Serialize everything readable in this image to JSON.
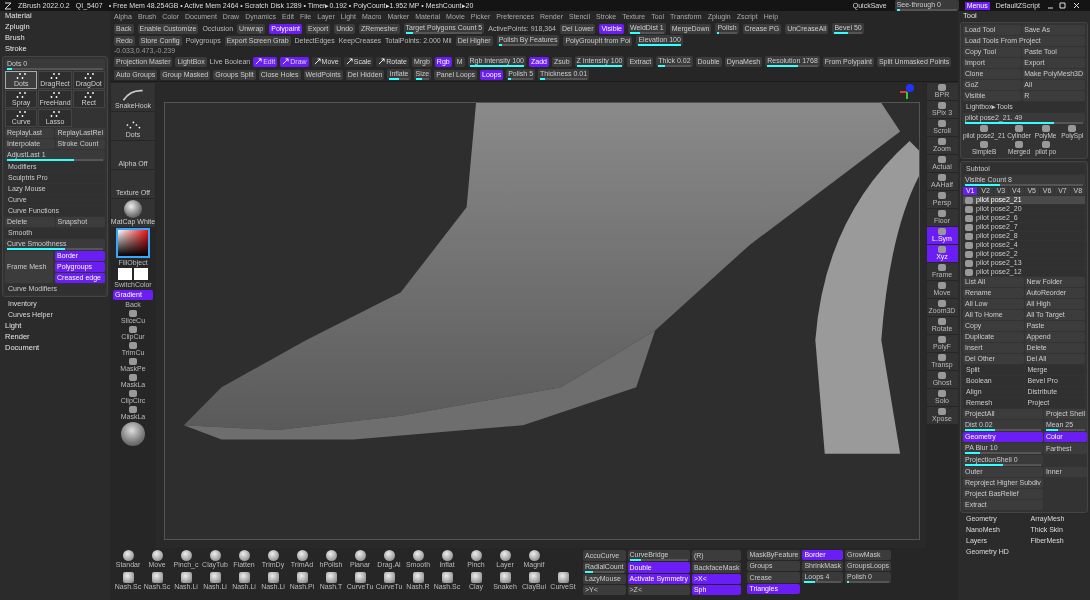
{
  "title_bar": {
    "app": "ZBrush 2022.0.2",
    "file": "QI_5407",
    "stats": "• Free Mem 48.254GB • Active Mem 2464 • Scratch Disk 1289 • Timer▸0.192 • PolyCount▸1.952 MP • MeshCount▸20",
    "quicksave": "QuickSave",
    "see_through": {
      "label": "See-through 0",
      "level": 0.05
    },
    "menus": {
      "label": "Menus",
      "selected": true
    },
    "script": "DefaultZScript"
  },
  "menu_bar": [
    "Alpha",
    "Brush",
    "Color",
    "Document",
    "Draw",
    "Dynamics",
    "Edit",
    "File",
    "Layer",
    "Light",
    "Macro",
    "Marker",
    "Material",
    "Movie",
    "Picker",
    "Preferences",
    "Render",
    "Stencil",
    "Stroke",
    "Texture",
    "Tool",
    "Transform",
    "Zplugin",
    "Zscript",
    "Help"
  ],
  "top_shelf": {
    "rows": [
      {
        "items": [
          {
            "kind": "button",
            "label": "Back",
            "selected": false
          },
          {
            "kind": "button",
            "label": "Enable Customize",
            "selected": false
          },
          {
            "kind": "label",
            "label": "Occlusion"
          },
          {
            "kind": "button",
            "label": "Unwrap",
            "selected": false
          },
          {
            "kind": "button",
            "label": "Polypaint",
            "selected": true
          },
          {
            "kind": "button",
            "label": "Export",
            "selected": false
          },
          {
            "kind": "button",
            "label": "Undo",
            "selected": false
          },
          {
            "kind": "button",
            "label": "ZRemesher",
            "selected": false
          },
          {
            "kind": "slider",
            "label": "Target Polygons Count 5",
            "level": 0.1
          },
          {
            "kind": "label",
            "label": "ActivePoints: 918,364"
          },
          {
            "kind": "button",
            "label": "Del Lower",
            "selected": false
          },
          {
            "kind": "button",
            "label": "Visible",
            "selected": true
          },
          {
            "kind": "slider",
            "label": "WeldDist 1",
            "level": 0.3
          },
          {
            "kind": "button",
            "label": "MergeDown",
            "selected": false
          },
          {
            "kind": "slider",
            "label": "Polish",
            "level": 0.1
          },
          {
            "kind": "button",
            "label": "Crease PG",
            "selected": false
          },
          {
            "kind": "button",
            "label": "UnCreaseAll",
            "selected": false
          },
          {
            "kind": "slider",
            "label": "Bevel 50",
            "level": 0.5
          }
        ]
      },
      {
        "items": [
          {
            "kind": "button",
            "label": "Redo",
            "selected": false
          },
          {
            "kind": "button",
            "label": "Store Config",
            "selected": false
          },
          {
            "kind": "label",
            "label": "Polygroups"
          },
          {
            "kind": "button",
            "label": "Export Screen Grab",
            "selected": false
          },
          {
            "kind": "label",
            "label": "DetectEdges"
          },
          {
            "kind": "label",
            "label": "KeepCreases"
          },
          {
            "kind": "label",
            "label": "TotalPoints: 2.000 Mil"
          },
          {
            "kind": "button",
            "label": "Del Higher",
            "selected": false
          },
          {
            "kind": "slider",
            "label": "Polish By Features",
            "level": 0.05
          },
          {
            "kind": "button",
            "label": "PolyGroupIt from Poi",
            "selected": false
          },
          {
            "kind": "slider",
            "label": "Elevation 100",
            "level": 1
          }
        ]
      }
    ],
    "coordinates": "-0.033,0.473,-0.239"
  },
  "toolbar": [
    {
      "kind": "button",
      "label": "Projection Master",
      "selected": false
    },
    {
      "kind": "button",
      "label": "LightBox",
      "selected": false
    },
    {
      "kind": "label",
      "label": "Live Boolean"
    },
    {
      "kind": "tool",
      "label": "Edit",
      "selected": true
    },
    {
      "kind": "tool",
      "label": "Draw",
      "selected": true
    },
    {
      "kind": "tool",
      "label": "Move",
      "selected": false
    },
    {
      "kind": "tool",
      "label": "Scale",
      "selected": false
    },
    {
      "kind": "tool",
      "label": "Rotate",
      "selected": false
    },
    {
      "kind": "button",
      "label": "Mrgb",
      "selected": false
    },
    {
      "kind": "button",
      "label": "Rgb",
      "selected": true
    },
    {
      "kind": "button",
      "label": "M",
      "selected": false
    },
    {
      "kind": "slider",
      "label": "Rgb Intensity 100",
      "level": 1
    },
    {
      "kind": "button",
      "label": "Zadd",
      "selected": true
    },
    {
      "kind": "button",
      "label": "Zsub",
      "selected": false
    },
    {
      "kind": "slider",
      "label": "Z Intensity 100",
      "level": 1
    },
    {
      "kind": "button",
      "label": "Extract",
      "selected": false
    },
    {
      "kind": "slider",
      "label": "Thick 0.02",
      "level": 0.2
    },
    {
      "kind": "button",
      "label": "Double",
      "selected": false
    },
    {
      "kind": "button",
      "label": "DynaMesh",
      "selected": false
    },
    {
      "kind": "slider",
      "label": "Resolution 1768",
      "level": 0.6
    },
    {
      "kind": "button",
      "label": "From Polypaint",
      "selected": false
    },
    {
      "kind": "button",
      "label": "Split Unmasked Points",
      "selected": false
    },
    {
      "kind": "button",
      "label": "Auto Groups",
      "selected": false
    },
    {
      "kind": "button",
      "label": "Group Masked",
      "selected": false
    },
    {
      "kind": "button",
      "label": "Groups Split",
      "selected": false
    },
    {
      "kind": "button",
      "label": "Close Holes",
      "selected": false
    },
    {
      "kind": "button",
      "label": "WeldPoints",
      "selected": false
    },
    {
      "kind": "button",
      "label": "Del Hidden",
      "selected": false
    },
    {
      "kind": "slider",
      "label": "Inflate",
      "level": 0.5
    },
    {
      "kind": "slider",
      "label": "Size",
      "level": 0.5
    },
    {
      "kind": "button",
      "label": "Panel Loops",
      "selected": false
    },
    {
      "kind": "button",
      "label": "Loops",
      "selected": true
    },
    {
      "kind": "slider",
      "label": "Polish 5",
      "level": 0.1
    },
    {
      "kind": "slider",
      "label": "Thickness 0.01",
      "level": 0.1
    }
  ],
  "left_palette": {
    "headers": [
      "Material",
      "Zplugin",
      "Brush"
    ],
    "stroke": {
      "title": "Stroke",
      "dots": {
        "label": "Dots 0",
        "level": 0.05
      },
      "types": [
        {
          "label": "Dots",
          "selected": true
        },
        {
          "label": "DragRect",
          "selected": false
        },
        {
          "label": "DragDot",
          "selected": false
        },
        {
          "label": "Spray",
          "selected": false
        },
        {
          "label": "FreeHand",
          "selected": false
        },
        {
          "label": "Rect",
          "selected": false
        },
        {
          "label": "Curve",
          "selected": false
        },
        {
          "label": "Lasso",
          "selected": false
        }
      ],
      "items": [
        {
          "kind": "pair",
          "labels": [
            "ReplayLast",
            "ReplayLastRel"
          ]
        },
        {
          "kind": "pair",
          "labels": [
            "Interpolate",
            "Stroke Count"
          ]
        },
        {
          "kind": "slider",
          "label": "AdjustLast 1",
          "level": 0.7
        },
        {
          "kind": "section",
          "label": "Modifiers"
        },
        {
          "kind": "section",
          "label": "Sculptris Pro"
        },
        {
          "kind": "section",
          "label": "Lazy Mouse"
        },
        {
          "kind": "section",
          "label": "Curve"
        },
        {
          "kind": "section",
          "label": "Curve Functions"
        },
        {
          "kind": "pair",
          "labels": [
            "Delete",
            "Snapshot"
          ]
        },
        {
          "kind": "section",
          "label": "Smooth"
        },
        {
          "kind": "slider",
          "label": "Curve Smoothness",
          "level": 0.6
        },
        {
          "kind": "frame",
          "label": "Frame Mesh",
          "options": [
            {
              "label": "Border",
              "selected": true
            },
            {
              "label": "Polygroups",
              "selected": true
            },
            {
              "label": "Creased edge",
              "selected": true
            }
          ]
        },
        {
          "kind": "section",
          "label": "Curve Modifiers"
        }
      ]
    },
    "extras": [
      "Inventory",
      "Curves Helper"
    ],
    "footer_headers": [
      "Light",
      "Render",
      "Document"
    ]
  },
  "left_shelf": {
    "brush": "SnakeHook",
    "stroke": "Dots",
    "alpha": "Alpha Off",
    "texture": "Texture Off",
    "material": "MatCap White",
    "fill": "FillObject",
    "switch": "SwitchColor",
    "gradient": {
      "label": "Gradient",
      "selected": true
    },
    "back": "Back",
    "tools": [
      "SliceCu",
      "ClipCur",
      "TrimCu",
      "MaskPe",
      "MaskLa",
      "ClipCirc",
      "MaskLa"
    ]
  },
  "right_shelf": [
    {
      "label": "BPR",
      "selected": false
    },
    {
      "label": "SPix 3",
      "selected": false
    },
    {
      "label": "Scroll",
      "selected": false
    },
    {
      "label": "Zoom",
      "selected": false
    },
    {
      "label": "Actual",
      "selected": false
    },
    {
      "label": "AAHalf",
      "selected": false
    },
    {
      "label": "Persp",
      "selected": false
    },
    {
      "label": "Floor",
      "selected": false
    },
    {
      "label": "L.Sym",
      "selected": true
    },
    {
      "label": "Xyz",
      "selected": true
    },
    {
      "label": "Frame",
      "selected": false
    },
    {
      "label": "Move",
      "selected": false
    },
    {
      "label": "Zoom3D",
      "selected": false
    },
    {
      "label": "Rotate",
      "selected": false
    },
    {
      "label": "PolyF",
      "selected": false
    },
    {
      "label": "Transp",
      "selected": false
    },
    {
      "label": "Ghost",
      "selected": false
    },
    {
      "label": "Solo",
      "selected": false
    },
    {
      "label": "Xpose",
      "selected": false
    }
  ],
  "tool_palette": {
    "title": "Tool",
    "buttons": [
      {
        "label": "Load Tool",
        "wide": false
      },
      {
        "label": "Save As",
        "wide": false
      },
      {
        "label": "Load Tools From Project",
        "wide": true
      },
      {
        "label": "Copy Tool",
        "wide": false
      },
      {
        "label": "Paste Tool",
        "wide": false
      },
      {
        "label": "Import",
        "wide": false
      },
      {
        "label": "Export",
        "wide": false
      },
      {
        "label": "Clone",
        "wide": false
      },
      {
        "label": "Make PolyMesh3D",
        "wide": false
      },
      {
        "label": "GoZ",
        "wide": false
      },
      {
        "label": "All",
        "wide": false
      },
      {
        "label": "Visible",
        "wide": false
      },
      {
        "label": "R",
        "wide": false
      }
    ],
    "lightbox": "Lightbox▸Tools",
    "current": {
      "label": "pilot pose2_21. 49",
      "level": 0.75
    },
    "thumbnails": [
      "pilot pose2_21",
      "Cylinder",
      "PolyMe",
      "PolySpl",
      "SimpleB",
      "Merged",
      "pilot po"
    ],
    "subtool": {
      "title": "Subtool",
      "visible_count": {
        "label": "Visible Count 8",
        "level": 0.3
      },
      "versions": [
        {
          "label": "V1",
          "selected": true
        },
        {
          "label": "V2",
          "selected": false
        },
        {
          "label": "V3",
          "selected": false
        },
        {
          "label": "V4",
          "selected": false
        },
        {
          "label": "V5",
          "selected": false
        },
        {
          "label": "V6",
          "selected": false
        },
        {
          "label": "V7",
          "selected": false
        },
        {
          "label": "V8",
          "selected": false
        }
      ],
      "items": [
        {
          "name": "pilot pose2_21",
          "selected": true
        },
        {
          "name": "pilot pose2_20",
          "selected": false
        },
        {
          "name": "pilot pose2_6",
          "selected": false
        },
        {
          "name": "pilot pose2_7",
          "selected": false
        },
        {
          "name": "pilot pose2_8",
          "selected": false
        },
        {
          "name": "pilot pose2_4",
          "selected": false
        },
        {
          "name": "pilot pose2_2",
          "selected": false
        },
        {
          "name": "pilot pose2_13",
          "selected": false
        },
        {
          "name": "pilot pose2_12",
          "selected": false
        }
      ],
      "actions": [
        "List All",
        "New Folder",
        "Rename",
        "AutoReorder",
        "All Low",
        "All High",
        "All To Home",
        "All To Target",
        "Copy",
        "Paste",
        "Duplicate",
        "Append",
        "Insert",
        "Delete",
        "Del Other",
        "Del All"
      ],
      "sections": [
        "Split",
        "Merge",
        "Boolean",
        "Bevel Pro",
        "Align",
        "Distribute",
        "Remesh",
        "Project"
      ],
      "project": [
        {
          "kind": "button",
          "label": "ProjectAll",
          "selected": false
        },
        {
          "kind": "button",
          "label": "Project Shell",
          "selected": false
        },
        {
          "kind": "slider",
          "label": "Dist 0.02",
          "level": 0.4
        },
        {
          "kind": "slider",
          "label": "Mean 25",
          "level": 0.3
        },
        {
          "kind": "button",
          "label": "Geometry",
          "selected": true
        },
        {
          "kind": "button",
          "label": "Color",
          "selected": true
        },
        {
          "kind": "slider",
          "label": "PA Blur 10",
          "level": 0.2
        },
        {
          "kind": "button",
          "label": "Farthest",
          "selected": false
        },
        {
          "kind": "slider",
          "label": "ProjectionShell 0",
          "level": 0.5
        },
        {
          "kind": "spacer"
        },
        {
          "kind": "button",
          "label": "Outer",
          "selected": false
        },
        {
          "kind": "button",
          "label": "Inner",
          "selected": false
        },
        {
          "kind": "button",
          "label": "Reproject Higher Subdiv",
          "selected": false
        },
        {
          "kind": "spacer"
        },
        {
          "kind": "button",
          "label": "Project BasRelief",
          "selected": false
        },
        {
          "kind": "spacer"
        },
        {
          "kind": "button",
          "label": "Extract",
          "selected": false
        }
      ]
    },
    "footer": [
      "Geometry",
      "ArrayMesh",
      "NanoMesh",
      "Thick Skin",
      "Layers",
      "FiberMesh",
      "Geometry HD"
    ]
  },
  "bottom_shelf": {
    "brushes_row_1": [
      "Standar",
      "Move",
      "Pinch_c",
      "ClayTub",
      "Flatten",
      "TrimDy",
      "TrimAd",
      "hPolish",
      "Planar",
      "Drag.Al",
      "Smooth",
      "Inflat",
      "Pinch",
      "Layer",
      "Magnif"
    ],
    "brushes_row_2": [
      "Nash.Sc",
      "Nash.Sc",
      "Nash.Li",
      "Nash.Li",
      "Nash.Li",
      "Nash.Li",
      "Nash.Pi",
      "Nash.T",
      "CurveTu",
      "CurveTu",
      "Nash.R",
      "Nash.Sc",
      "Clay",
      "Snakeh",
      "ClayBui",
      "CurveSt"
    ],
    "options": [
      {
        "kind": "button",
        "label": "AccuCurve",
        "selected": false
      },
      {
        "kind": "slider",
        "label": "CurveBridge",
        "level": 0.2
      },
      {
        "kind": "button",
        "label": "(R)",
        "selected": false
      },
      {
        "kind": "slider",
        "label": "RadialCount",
        "level": 0.2
      },
      {
        "kind": "button",
        "label": "Double",
        "selected": true
      },
      {
        "kind": "button",
        "label": "BackfaceMask",
        "selected": false
      },
      {
        "kind": "button",
        "label": "LazyMouse",
        "selected": false
      },
      {
        "kind": "button",
        "label": "Activate Symmetry",
        "selected": true
      },
      {
        "kind": "button",
        "label": ">X<",
        "selected": true
      },
      {
        "kind": "button",
        "label": ">Y<",
        "selected": false
      },
      {
        "kind": "button",
        "label": ">Z<",
        "selected": false
      },
      {
        "kind": "button",
        "label": "Sph",
        "selected": true
      }
    ],
    "mask": [
      {
        "kind": "button",
        "label": "MaskByFeature",
        "selected": false
      },
      {
        "kind": "button",
        "label": "Border",
        "selected": true
      },
      {
        "kind": "button",
        "label": "GrowMask",
        "selected": false
      },
      {
        "kind": "button",
        "label": "Groups",
        "selected": false
      },
      {
        "kind": "button",
        "label": "ShrinkMask",
        "selected": false
      },
      {
        "kind": "button",
        "label": "GroupsLoops",
        "selected": false
      },
      {
        "kind": "button",
        "label": "Crease",
        "selected": false
      },
      {
        "kind": "slider",
        "label": "Loops 4",
        "level": 0.3
      },
      {
        "kind": "slider",
        "label": "Polish 0",
        "level": 0.05
      },
      {
        "kind": "button",
        "label": "Triangles",
        "selected": true
      }
    ]
  }
}
